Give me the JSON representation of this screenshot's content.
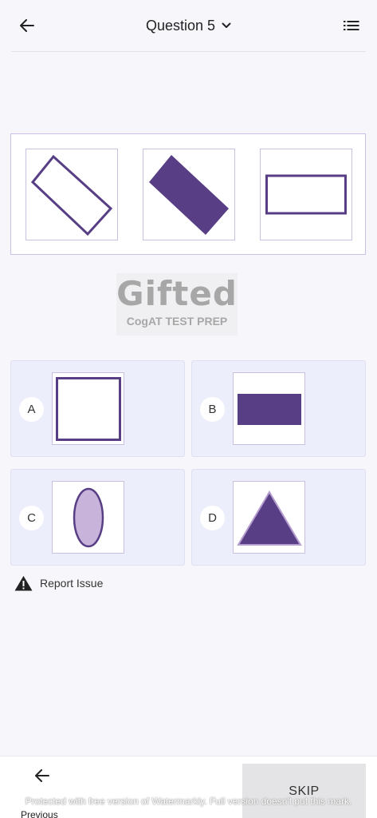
{
  "header": {
    "title": "Question 5",
    "back_icon": "arrow-left-icon",
    "dropdown_icon": "chevron-down-icon",
    "list_icon": "list-icon"
  },
  "question": {
    "figures": [
      {
        "shape": "rectangle-tilted-outline"
      },
      {
        "shape": "rectangle-tilted-filled"
      },
      {
        "shape": "rectangle-horizontal-outline"
      }
    ]
  },
  "logo": {
    "title": "Gifted",
    "subtitle": "CogAT TEST PREP"
  },
  "options": [
    {
      "letter": "A",
      "shape": "square-outline"
    },
    {
      "letter": "B",
      "shape": "rectangle-filled"
    },
    {
      "letter": "C",
      "shape": "ellipse-light-filled"
    },
    {
      "letter": "D",
      "shape": "triangle-filled"
    }
  ],
  "report": {
    "label": "Report Issue",
    "icon": "warning-icon"
  },
  "footer": {
    "previous_label": "Previous",
    "skip_label": "SKIP",
    "watermark": "Protected with free version of Watermarkly. Full version doesn't put this mark."
  },
  "colors": {
    "accent": "#573e85",
    "light_accent": "#c8b3db",
    "option_bg": "#edeefb",
    "skip_bg": "#e4e4e6"
  }
}
